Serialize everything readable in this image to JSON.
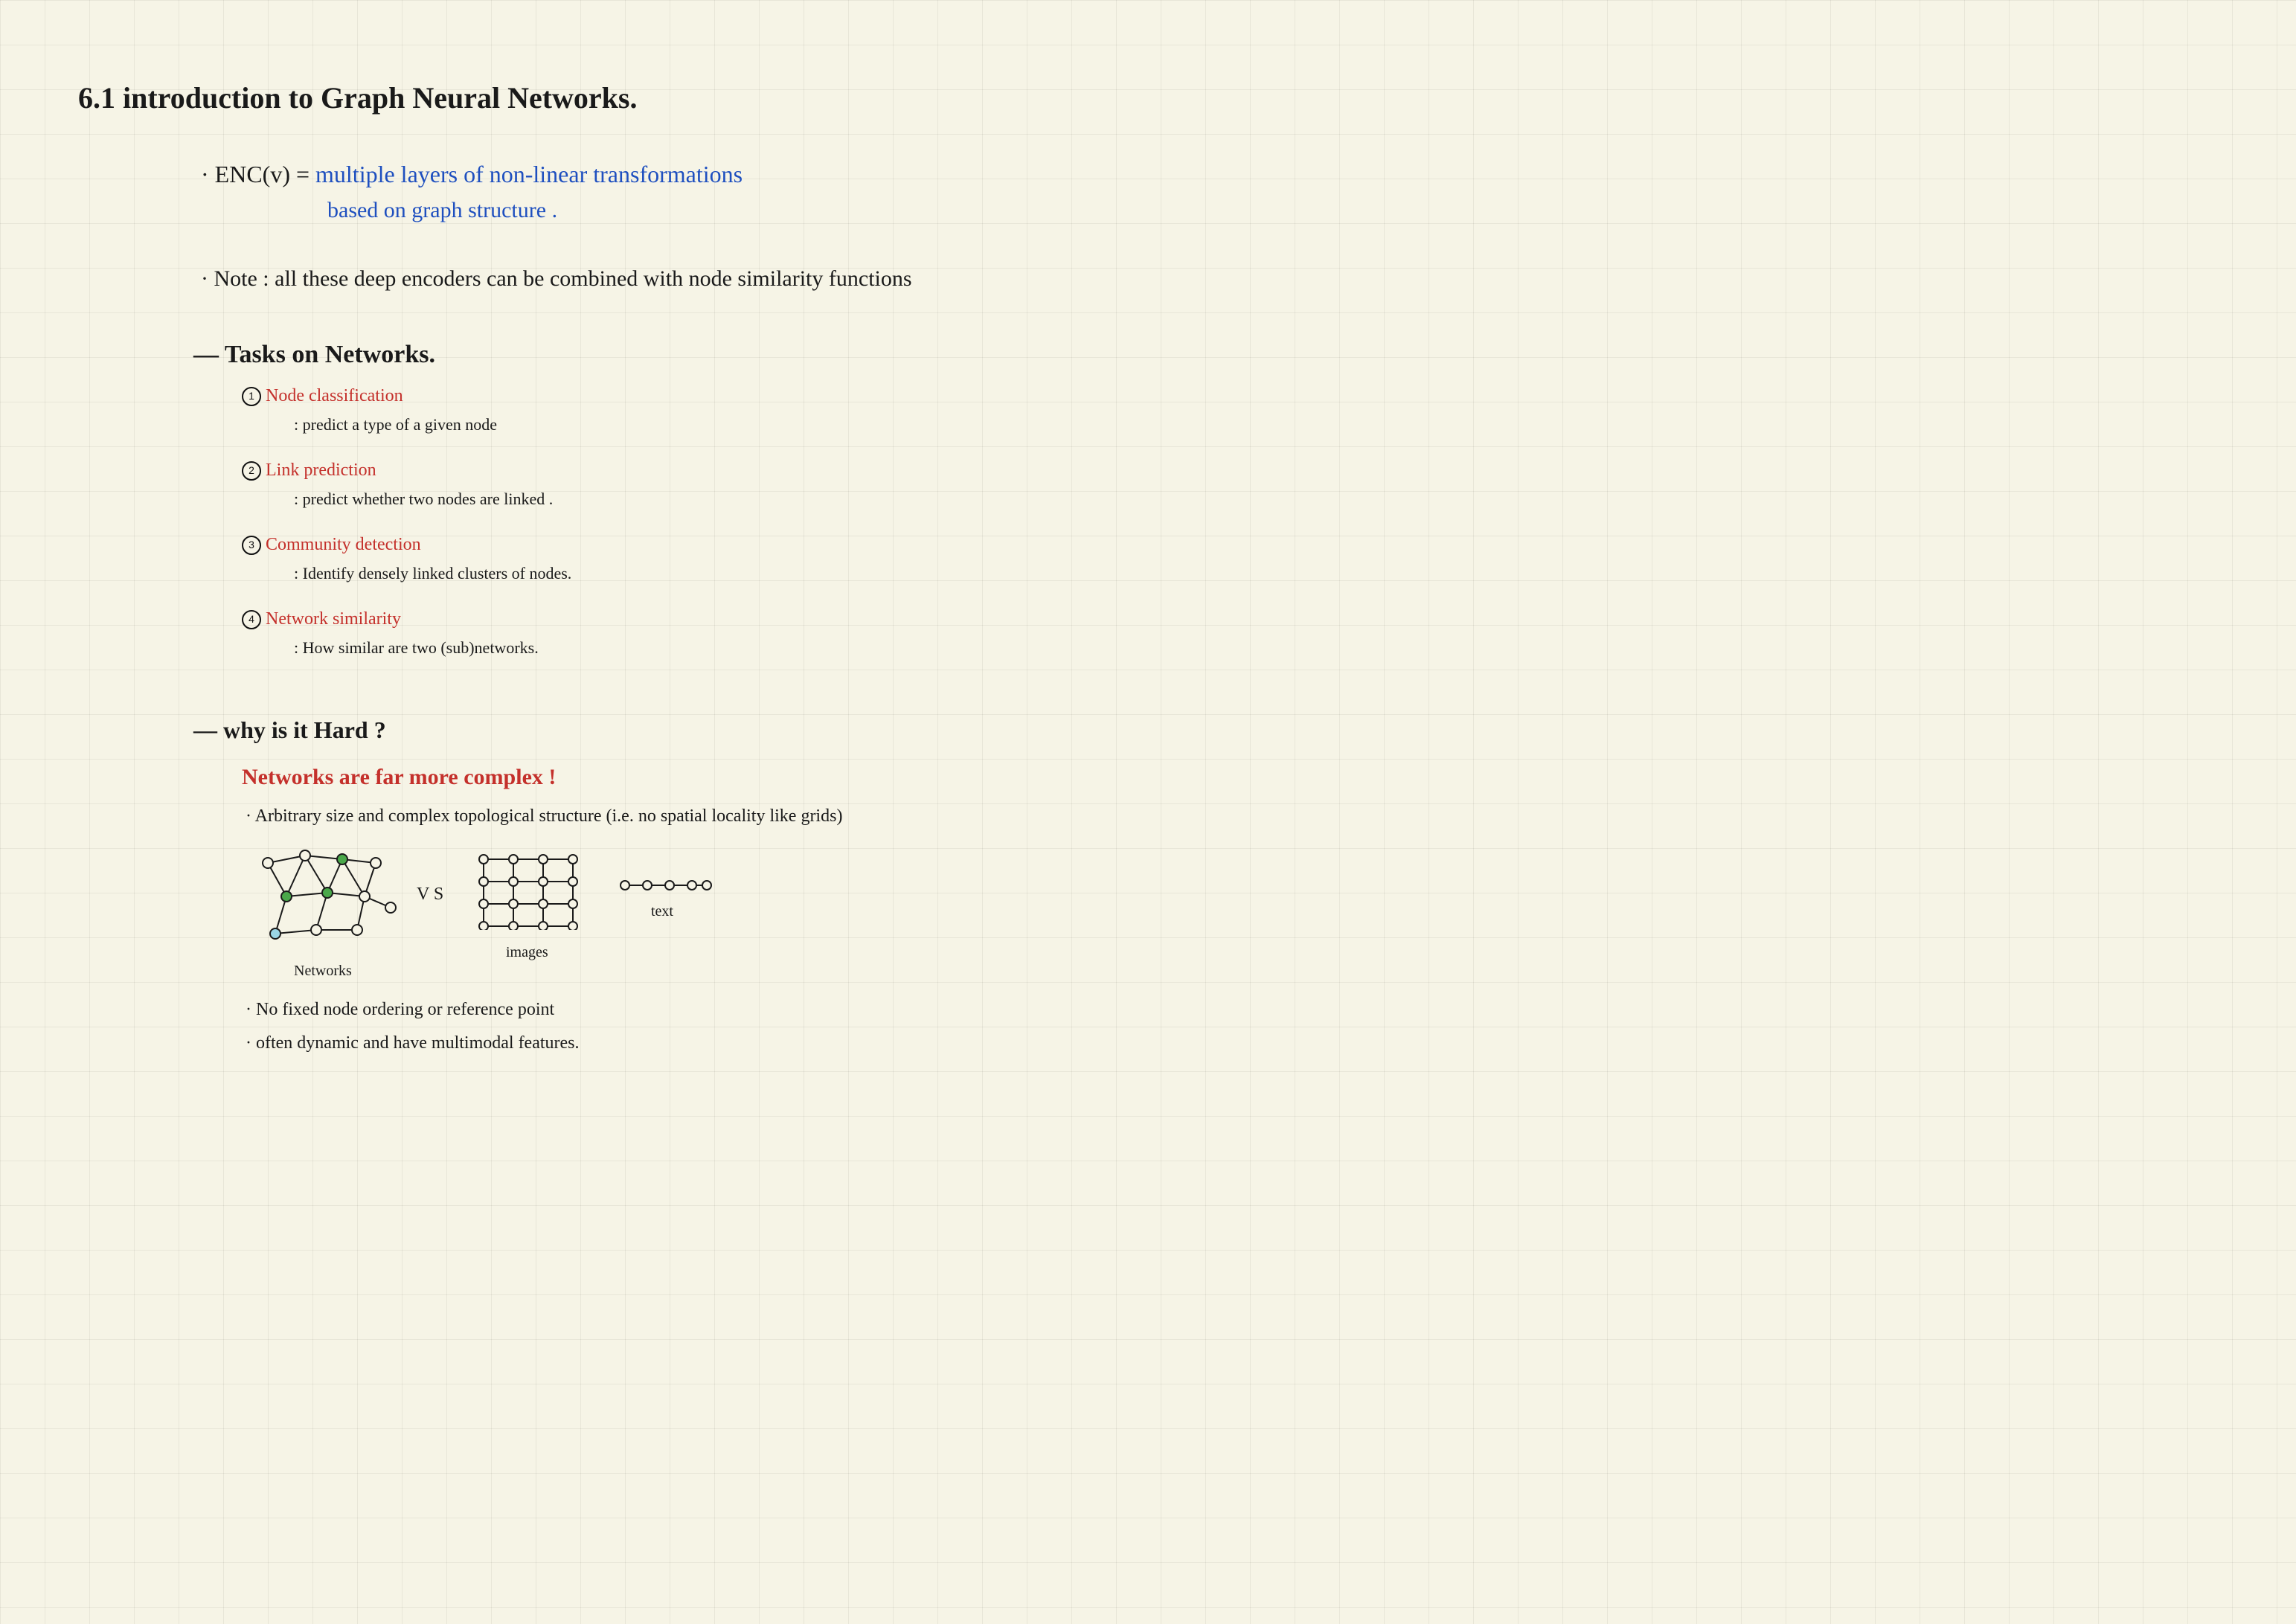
{
  "title": "6.1  introduction to Graph Neural Networks.",
  "enc_prefix": "· ENC(v) = ",
  "enc_line1": "multiple layers of non-linear transformations",
  "enc_line2": "based on graph structure .",
  "note_line": "· Note : all these deep encoders can be combined with node similarity functions",
  "tasks_heading": "— Tasks on Networks.",
  "task1_title": "Node classification",
  "task1_desc": ": predict a type of a given node",
  "task2_title": "Link prediction",
  "task2_desc": ": predict whether two nodes are linked .",
  "task3_title": "Community detection",
  "task3_desc": ": Identify densely linked clusters of nodes.",
  "task4_title": "Network similarity",
  "task4_desc": ": How similar are two (sub)networks.",
  "hard_heading": "— why is it Hard ?",
  "hard_complex": "Networks are far more complex !",
  "hard_bullet1": "· Arbitrary size and complex topological structure (i.e. no spatial locality like grids)",
  "vs_label": "V S",
  "label_networks": "Networks",
  "label_images": "images",
  "label_text": "text",
  "hard_bullet2": "· No fixed node ordering or reference point",
  "hard_bullet3": "· often dynamic and have multimodal features.",
  "circ": {
    "one": "1",
    "two": "2",
    "three": "3",
    "four": "4"
  }
}
